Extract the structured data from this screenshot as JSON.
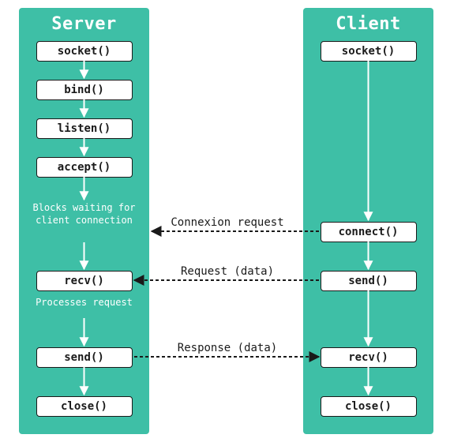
{
  "colors": {
    "teal": "#3ebfa6",
    "ink": "#1a1a1a",
    "white": "#ffffff"
  },
  "server": {
    "title": "Server",
    "nodes": {
      "socket": "socket()",
      "bind": "bind()",
      "listen": "listen()",
      "accept": "accept()",
      "recv": "recv()",
      "send": "send()",
      "close": "close()"
    },
    "notes": {
      "blocks": "Blocks waiting for client connection",
      "processes": "Processes request"
    }
  },
  "client": {
    "title": "Client",
    "nodes": {
      "socket": "socket()",
      "connect": "connect()",
      "send": "send()",
      "recv": "recv()",
      "close": "close()"
    }
  },
  "edges": {
    "connexion": "Connexion request",
    "request": "Request (data)",
    "response": "Response (data)"
  }
}
